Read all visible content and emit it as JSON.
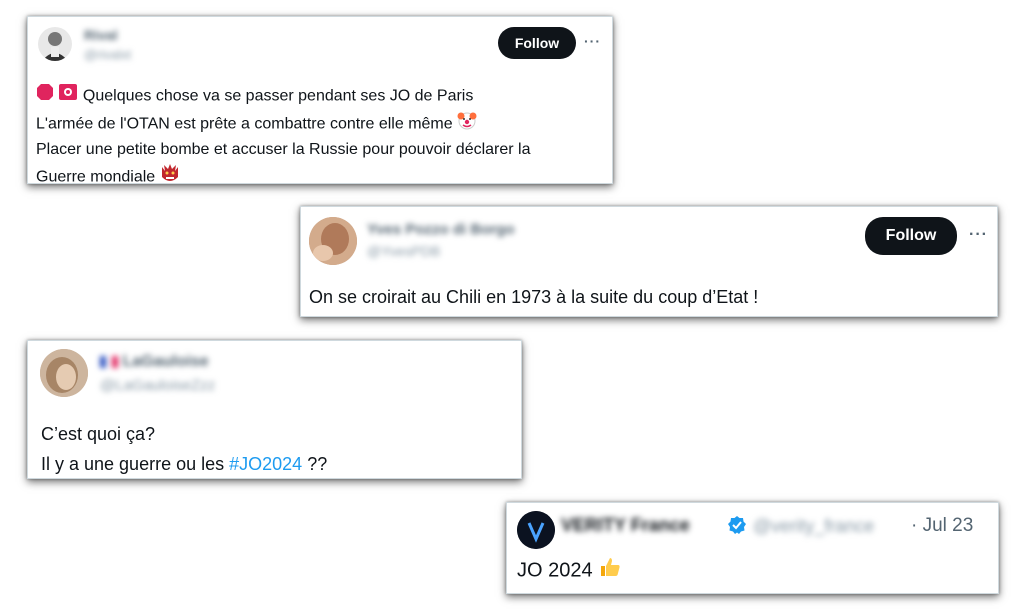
{
  "tweet1": {
    "name": "Rival",
    "handle": "@rivalxt",
    "follow_label": "Follow",
    "more_label": "···",
    "line1": "Quelques chose va se passer pendant ses JO de Paris",
    "line2": "L'armée de l'OTAN est prête a combattre contre elle même",
    "line3": "Placer une petite bombe et accuser la Russie pour pouvoir déclarer la",
    "line4": "Guerre mondiale"
  },
  "tweet2": {
    "name": "Yves Pozzo di Borgo",
    "handle": "@YvesPDB",
    "follow_label": "Follow",
    "more_label": "···",
    "text": "On se croirait au Chili en 1973 à la suite du coup d’Etat !"
  },
  "tweet3": {
    "name": "LaGauloise",
    "handle": "@LaGauloiseZzz",
    "line1": "C’est quoi ça?",
    "line2_prefix": "Il y a une guerre ou les ",
    "hashtag": "#JO2024",
    "line2_suffix": " ??"
  },
  "tweet4": {
    "name": "VERITY France",
    "handle": "@verity_france",
    "date": "· Jul 23",
    "text": "JO 2024"
  },
  "colors": {
    "follow_bg": "#0f1419",
    "hashtag": "#1d9bf0",
    "verified": "#1d9bf0"
  }
}
